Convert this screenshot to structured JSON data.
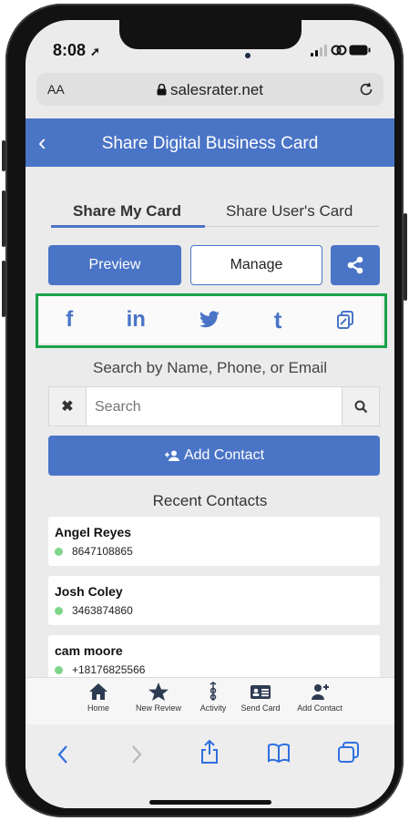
{
  "status_bar": {
    "time": "8:08"
  },
  "browser": {
    "text_size_label": "AA",
    "domain": "salesrater.net"
  },
  "header": {
    "title": "Share Digital Business Card"
  },
  "tabs": [
    {
      "label": "Share My Card",
      "active": true
    },
    {
      "label": "Share User's Card",
      "active": false
    }
  ],
  "actions": {
    "preview_label": "Preview",
    "manage_label": "Manage"
  },
  "social": {
    "facebook": "f",
    "linkedin": "in",
    "tumblr": "t"
  },
  "search": {
    "label": "Search by Name, Phone, or Email",
    "placeholder": "Search"
  },
  "add_contact": {
    "label": "Add Contact"
  },
  "recent": {
    "title": "Recent Contacts",
    "contacts": [
      {
        "name": "Angel Reyes",
        "phone": "8647108865"
      },
      {
        "name": "Josh Coley",
        "phone": "3463874860"
      },
      {
        "name": "cam moore",
        "phone": "+18176825566"
      }
    ]
  },
  "bottom_nav": [
    {
      "label": "Home",
      "icon": "home-icon"
    },
    {
      "label": "New Review",
      "icon": "star-icon"
    },
    {
      "label": "Activity",
      "icon": "activity-icon"
    },
    {
      "label": "Send Card",
      "icon": "card-icon"
    },
    {
      "label": "Add Contact",
      "icon": "add-person-icon"
    }
  ],
  "colors": {
    "primary": "#4a74c6",
    "highlight": "#1aa34a",
    "online": "#7fd68a"
  }
}
